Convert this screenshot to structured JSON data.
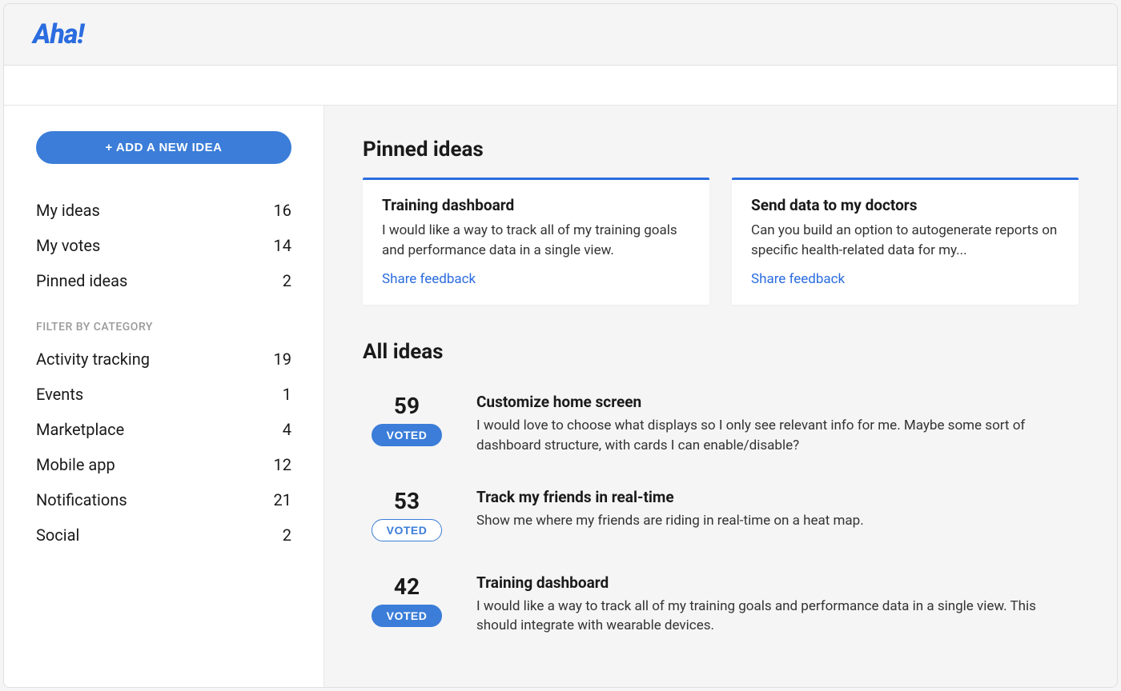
{
  "header": {
    "logo_text": "Aha!"
  },
  "sidebar": {
    "add_button_label": "+ ADD A NEW IDEA",
    "nav": [
      {
        "label": "My ideas",
        "count": "16"
      },
      {
        "label": "My votes",
        "count": "14"
      },
      {
        "label": "Pinned ideas",
        "count": "2"
      }
    ],
    "filter_heading": "FILTER BY CATEGORY",
    "categories": [
      {
        "label": "Activity tracking",
        "count": "19"
      },
      {
        "label": "Events",
        "count": "1"
      },
      {
        "label": "Marketplace",
        "count": "4"
      },
      {
        "label": "Mobile app",
        "count": "12"
      },
      {
        "label": "Notifications",
        "count": "21"
      },
      {
        "label": "Social",
        "count": "2"
      }
    ]
  },
  "sections": {
    "pinned_title": "Pinned ideas",
    "all_title": "All ideas"
  },
  "pinned": [
    {
      "title": "Training dashboard",
      "desc": "I would like a way to track all of my training goals and performance data in a single view.",
      "link": "Share feedback"
    },
    {
      "title": "Send data to my doctors",
      "desc": "Can you build an option to autogenerate reports on specific health-related data for my...",
      "link": "Share feedback"
    }
  ],
  "ideas": [
    {
      "votes": "59",
      "vote_label": "VOTED",
      "vote_style": "filled",
      "title": "Customize home screen",
      "desc": "I would love to choose what displays so I only see relevant info for me. Maybe some sort of dashboard structure, with cards I can enable/disable?"
    },
    {
      "votes": "53",
      "vote_label": "VOTED",
      "vote_style": "outline",
      "title": "Track my friends in real-time",
      "desc": "Show me where my friends are riding in real-time on a heat map."
    },
    {
      "votes": "42",
      "vote_label": "VOTED",
      "vote_style": "filled",
      "title": "Training dashboard",
      "desc": "I would like a way to track all of my training goals and performance data in a single view. This should integrate with wearable devices."
    }
  ]
}
